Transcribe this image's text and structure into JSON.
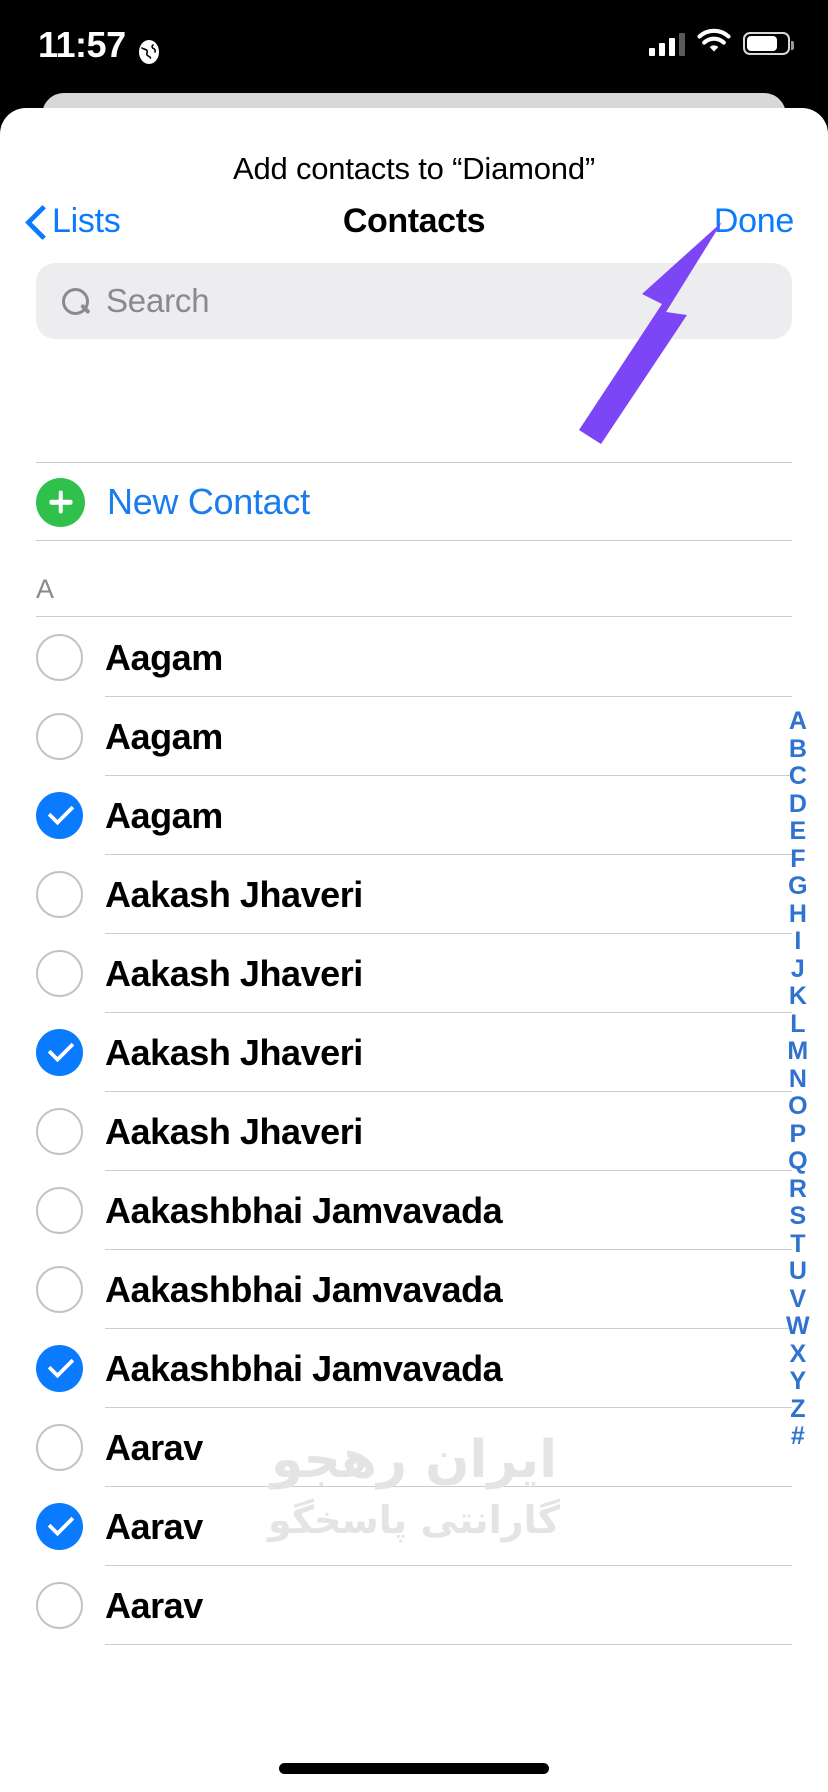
{
  "status_bar": {
    "time": "11:57",
    "location_icon": "globe-icon",
    "cellular_icon": "cellular-signal-icon",
    "wifi_icon": "wifi-icon",
    "battery_icon": "battery-icon"
  },
  "sheet": {
    "title": "Add contacts to “Diamond”"
  },
  "navbar": {
    "back_label": "Lists",
    "back_icon": "chevron-left-icon",
    "title": "Contacts",
    "done_label": "Done"
  },
  "search": {
    "placeholder": "Search",
    "value": "",
    "icon": "search-icon"
  },
  "new_contact": {
    "label": "New Contact",
    "icon": "plus-circle-icon"
  },
  "section": {
    "header": "A"
  },
  "contacts": [
    {
      "name": "Aagam",
      "checked": false
    },
    {
      "name": "Aagam",
      "checked": false
    },
    {
      "name": "Aagam",
      "checked": true
    },
    {
      "name": "Aakash Jhaveri",
      "checked": false
    },
    {
      "name": "Aakash Jhaveri",
      "checked": false
    },
    {
      "name": "Aakash Jhaveri",
      "checked": true
    },
    {
      "name": "Aakash Jhaveri",
      "checked": false
    },
    {
      "name": "Aakashbhai Jamvavada",
      "checked": false
    },
    {
      "name": "Aakashbhai Jamvavada",
      "checked": false
    },
    {
      "name": "Aakashbhai Jamvavada",
      "checked": true
    },
    {
      "name": "Aarav",
      "checked": false
    },
    {
      "name": "Aarav",
      "checked": true
    },
    {
      "name": "Aarav",
      "checked": false
    }
  ],
  "index_letters": [
    "A",
    "B",
    "C",
    "D",
    "E",
    "F",
    "G",
    "H",
    "I",
    "J",
    "K",
    "L",
    "M",
    "N",
    "O",
    "P",
    "Q",
    "R",
    "S",
    "T",
    "U",
    "V",
    "W",
    "X",
    "Y",
    "Z",
    "#"
  ],
  "watermark": {
    "line1": "ایران رهجو",
    "line2": "گارانتی پاسخگو"
  },
  "annotation": {
    "arrow_color": "#7c45f5",
    "points_to": "Done"
  },
  "colors": {
    "accent_blue": "#0a7aff",
    "link_blue": "#1b7ced",
    "index_blue": "#2f72cf",
    "green": "#2fc14c",
    "separator": "#cdcdd1",
    "search_bg": "#ededef",
    "placeholder_gray": "#8a8a8e"
  }
}
